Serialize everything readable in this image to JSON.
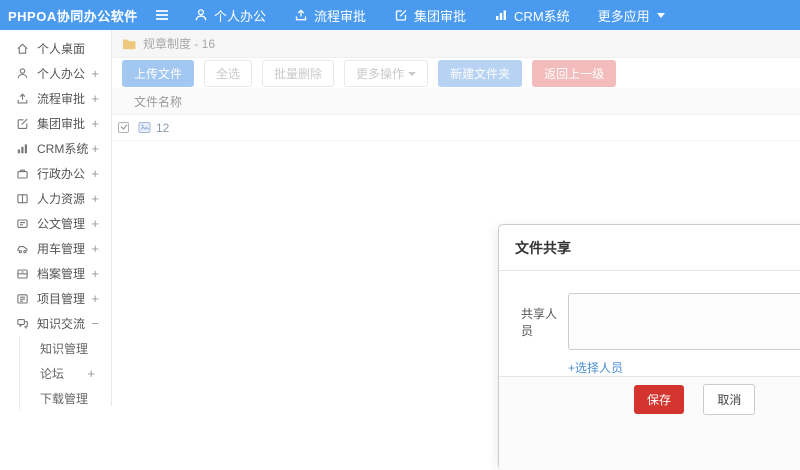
{
  "header": {
    "logo": "PHPOA协同办公软件",
    "nav": [
      {
        "label": "个人办公",
        "icon": "user-icon"
      },
      {
        "label": "流程审批",
        "icon": "upload-icon"
      },
      {
        "label": "集团审批",
        "icon": "edit-icon"
      },
      {
        "label": "CRM系统",
        "icon": "bar-chart-icon"
      },
      {
        "label": "更多应用",
        "icon": "caret-down-icon"
      }
    ]
  },
  "sidebar": {
    "items": [
      {
        "label": "个人桌面",
        "expand": ""
      },
      {
        "label": "个人办公",
        "expand": "+"
      },
      {
        "label": "流程审批",
        "expand": "+"
      },
      {
        "label": "集团审批",
        "expand": "+"
      },
      {
        "label": "CRM系统",
        "expand": "+"
      },
      {
        "label": "行政办公",
        "expand": "+"
      },
      {
        "label": "人力资源",
        "expand": "+"
      },
      {
        "label": "公文管理",
        "expand": "+"
      },
      {
        "label": "用车管理",
        "expand": "+"
      },
      {
        "label": "档案管理",
        "expand": "+"
      },
      {
        "label": "项目管理",
        "expand": "+"
      },
      {
        "label": "知识交流",
        "expand": "−"
      }
    ],
    "subitems": [
      {
        "label": "知识管理",
        "expand": ""
      },
      {
        "label": "论坛",
        "expand": "+"
      },
      {
        "label": "下载管理",
        "expand": ""
      }
    ]
  },
  "breadcrumb": {
    "label": "规章制度 - 16"
  },
  "toolbar": {
    "upload": "上传文件",
    "select_all": "全选",
    "batch_delete": "批量删除",
    "more_ops": "更多操作",
    "new_folder": "新建文件夹",
    "go_back": "返回上一级"
  },
  "table": {
    "header": "文件名称",
    "rows": [
      {
        "name": "12",
        "checked": true
      }
    ]
  },
  "modal": {
    "title": "文件共享",
    "share_label": "共享人员",
    "textarea_value": "",
    "select_link": "+选择人员",
    "save": "保存",
    "cancel": "取消"
  },
  "colors": {
    "header_blue": "#4a9bf0",
    "button_blue": "#a2c7f0",
    "button_light_blue": "#b7d2f3",
    "button_light_red": "#f3bcbc",
    "save_red": "#d4342e",
    "link_blue": "#4a8fd4",
    "folder_yellow": "#eec97d"
  }
}
